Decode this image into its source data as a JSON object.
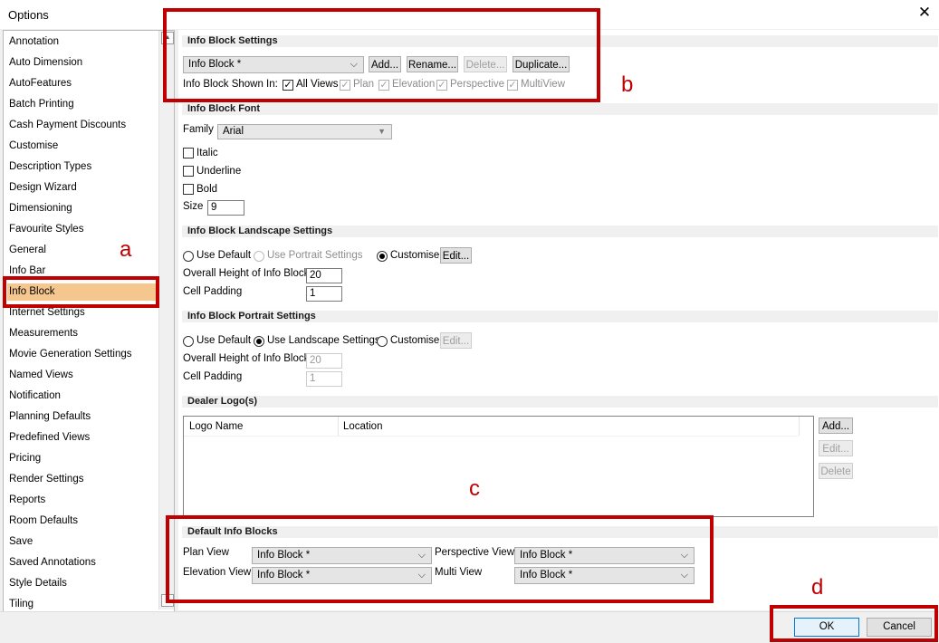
{
  "window": {
    "title": "Options",
    "close_icon": "close-icon"
  },
  "sidebar": {
    "items": [
      {
        "label": "Annotation"
      },
      {
        "label": "Auto Dimension"
      },
      {
        "label": "AutoFeatures"
      },
      {
        "label": "Batch Printing"
      },
      {
        "label": "Cash Payment Discounts"
      },
      {
        "label": "Customise"
      },
      {
        "label": "Description Types"
      },
      {
        "label": "Design Wizard"
      },
      {
        "label": "Dimensioning"
      },
      {
        "label": "Favourite Styles"
      },
      {
        "label": "General"
      },
      {
        "label": "Info Bar"
      },
      {
        "label": "Info Block"
      },
      {
        "label": "Internet Settings"
      },
      {
        "label": "Measurements"
      },
      {
        "label": "Movie Generation Settings"
      },
      {
        "label": "Named Views"
      },
      {
        "label": "Notification"
      },
      {
        "label": "Planning Defaults"
      },
      {
        "label": "Predefined Views"
      },
      {
        "label": "Pricing"
      },
      {
        "label": "Render Settings"
      },
      {
        "label": "Reports"
      },
      {
        "label": "Room Defaults"
      },
      {
        "label": "Save"
      },
      {
        "label": "Saved Annotations"
      },
      {
        "label": "Style Details"
      },
      {
        "label": "Tiling"
      }
    ],
    "selected": "Info Block"
  },
  "info_block_settings": {
    "header": "Info Block Settings",
    "selected": "Info Block *",
    "add": "Add...",
    "rename": "Rename...",
    "delete": "Delete...",
    "duplicate": "Duplicate...",
    "shown_in_label": "Info Block Shown In:",
    "all_views": "All Views",
    "plan": "Plan",
    "elevation": "Elevation",
    "perspective": "Perspective",
    "multiview": "MultiView"
  },
  "font": {
    "header": "Info Block Font",
    "family_label": "Family",
    "family_value": "Arial",
    "italic": "Italic",
    "underline": "Underline",
    "bold": "Bold",
    "size_label": "Size",
    "size_value": "9"
  },
  "landscape": {
    "header": "Info Block Landscape Settings",
    "use_default": "Use Default",
    "use_portrait": "Use Portrait Settings",
    "customise": "Customise",
    "edit": "Edit...",
    "height_label": "Overall Height of Info Block",
    "height_value": "20",
    "padding_label": "Cell Padding",
    "padding_value": "1"
  },
  "portrait": {
    "header": "Info Block Portrait Settings",
    "use_default": "Use Default",
    "use_landscape": "Use Landscape Settings",
    "customise": "Customise",
    "edit": "Edit...",
    "height_label": "Overall Height of Info Block",
    "height_value": "20",
    "padding_label": "Cell Padding",
    "padding_value": "1"
  },
  "logos": {
    "header": "Dealer Logo(s)",
    "columns": [
      "Logo Name",
      "Location"
    ],
    "add": "Add...",
    "edit": "Edit...",
    "delete": "Delete"
  },
  "defaults": {
    "header": "Default Info Blocks",
    "plan_label": "Plan View",
    "plan_value": "Info Block *",
    "elevation_label": "Elevation View",
    "elevation_value": "Info Block *",
    "perspective_label": "Perspective View",
    "perspective_value": "Info Block *",
    "multi_label": "Multi View",
    "multi_value": "Info Block *"
  },
  "footer": {
    "ok": "OK",
    "cancel": "Cancel"
  },
  "annotations": {
    "a": "a",
    "b": "b",
    "c": "c",
    "d": "d"
  },
  "colors": {
    "highlight": "#c00000",
    "selection": "#f5c78e",
    "default_button": "#0078d7"
  }
}
